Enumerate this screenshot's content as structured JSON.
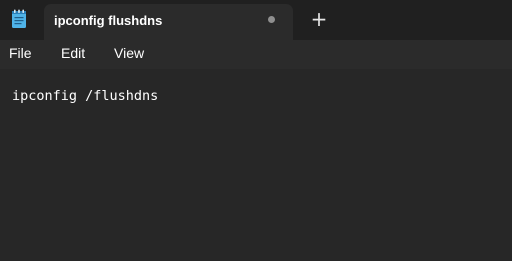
{
  "tab": {
    "title": "ipconfig flushdns",
    "unsaved_indicator": "unsaved-dot",
    "app_icon": "notepad-icon"
  },
  "new_tab": {
    "label": "+"
  },
  "menu": {
    "items": [
      {
        "label": "File"
      },
      {
        "label": "Edit"
      },
      {
        "label": "View"
      }
    ]
  },
  "editor": {
    "content": "ipconfig /flushdns"
  },
  "colors": {
    "titlebar": "#202020",
    "tab": "#2b2b2b",
    "editor_bg": "#272727",
    "icon_accent": "#4fb3e8"
  }
}
